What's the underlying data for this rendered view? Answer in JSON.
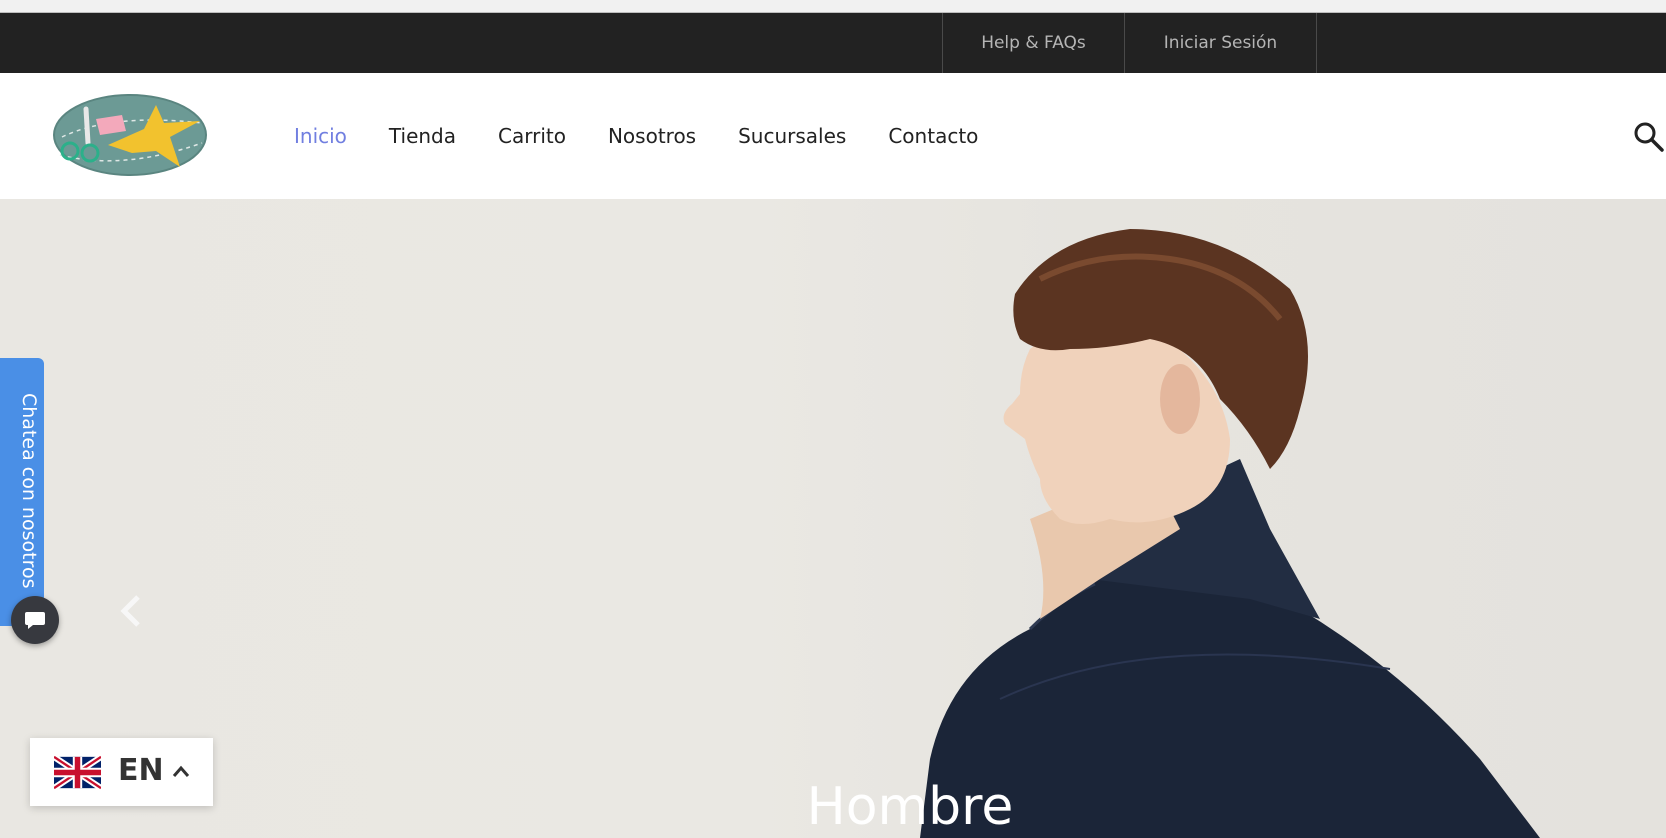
{
  "topbar": {
    "help_label": "Help & FAQs",
    "login_label": "Iniciar Sesión"
  },
  "header": {
    "logo_icon": "scissors-bird-logo",
    "nav": [
      {
        "label": "Inicio",
        "active": true
      },
      {
        "label": "Tienda",
        "active": false
      },
      {
        "label": "Carrito",
        "active": false
      },
      {
        "label": "Nosotros",
        "active": false
      },
      {
        "label": "Sucursales",
        "active": false
      },
      {
        "label": "Contacto",
        "active": false
      }
    ],
    "search_icon": "search-icon"
  },
  "hero": {
    "title": "Hombre",
    "prev_icon": "chevron-left-icon"
  },
  "chat": {
    "tab_label": "Chatea con nosotros",
    "button_icon": "chat-bubble-icon"
  },
  "language": {
    "code": "EN",
    "flag_icon": "uk-flag-icon",
    "chevron_icon": "chevron-up-icon"
  },
  "colors": {
    "accent": "#717fe0",
    "topbar_bg": "#222222",
    "chat_blue": "#4a8fe6"
  }
}
